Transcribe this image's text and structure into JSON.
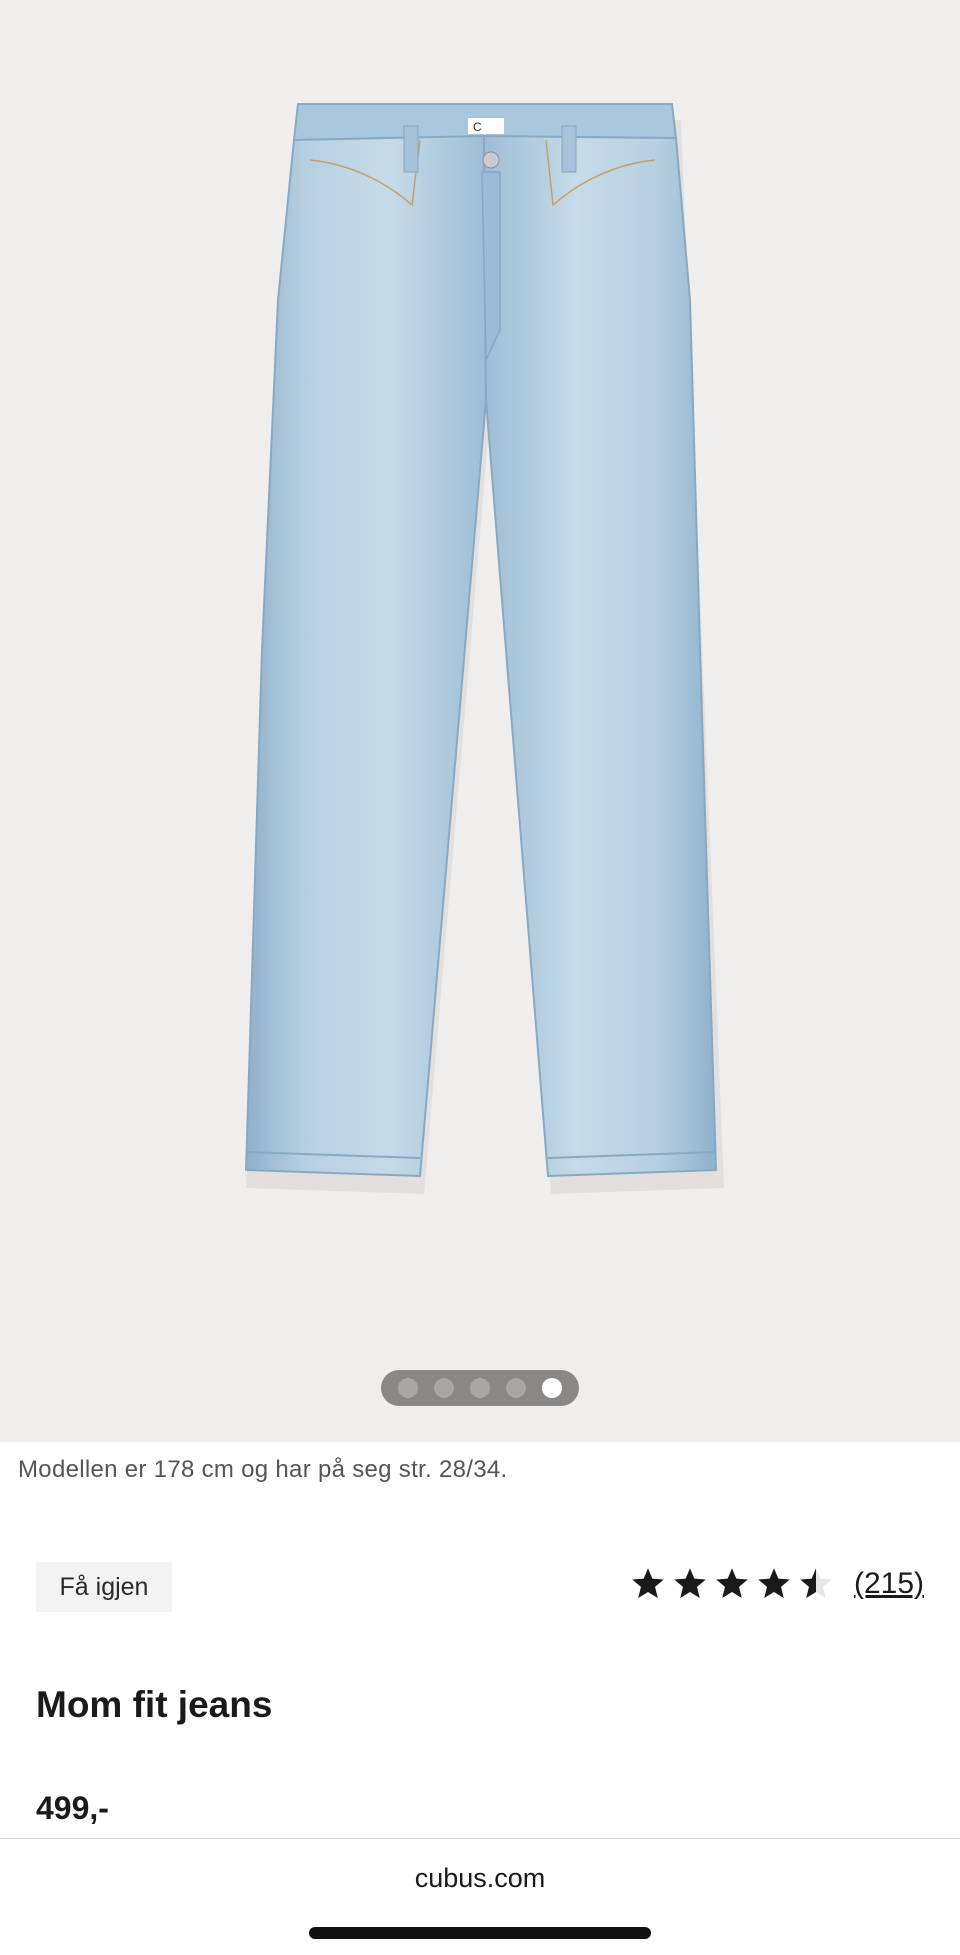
{
  "gallery": {
    "image_alt": "light-blue-jeans-image",
    "dots": [
      {
        "active": false
      },
      {
        "active": false
      },
      {
        "active": false
      },
      {
        "active": false
      },
      {
        "active": true
      }
    ]
  },
  "model_note": "Modellen er 178 cm og har på seg str. 28/34.",
  "badge_label": "Få igjen",
  "rating": {
    "value": 4.5,
    "max": 5,
    "count_label": "(215)"
  },
  "product": {
    "title": "Mom fit jeans",
    "price": "499,-"
  },
  "browser": {
    "domain": "cubus.com"
  },
  "colors": {
    "gallery_bg": "#f0eeed",
    "denim": "#a9c6d9",
    "star": "#1a1a1a",
    "star_empty": "#e6e6e6"
  }
}
